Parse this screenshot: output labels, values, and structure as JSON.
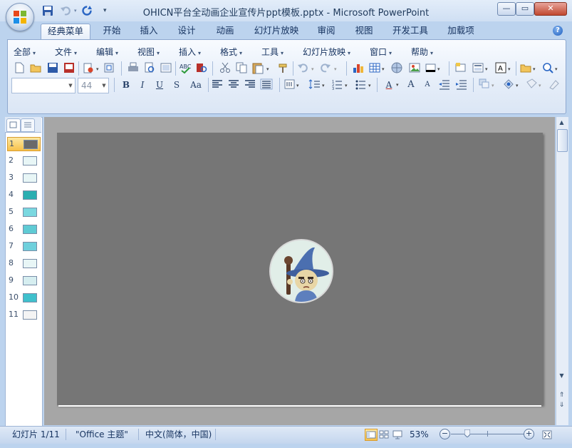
{
  "window": {
    "title": "OHICN平台全动画企业宣传片ppt模板.pptx - Microsoft PowerPoint",
    "controls": {
      "minimize": "—",
      "restore": "▭",
      "close": "✕"
    }
  },
  "quick_access": [
    "save-icon",
    "undo-icon",
    "redo-icon",
    "customize-icon"
  ],
  "ribbon_tabs": [
    {
      "label": "经典菜单",
      "active": true
    },
    {
      "label": "开始"
    },
    {
      "label": "插入"
    },
    {
      "label": "设计"
    },
    {
      "label": "动画"
    },
    {
      "label": "幻灯片放映"
    },
    {
      "label": "审阅"
    },
    {
      "label": "视图"
    },
    {
      "label": "开发工具"
    },
    {
      "label": "加载项"
    }
  ],
  "help_label": "?",
  "classic_menu": [
    "全部",
    "文件",
    "编辑",
    "视图",
    "插入",
    "格式",
    "工具",
    "幻灯片放映",
    "窗口",
    "帮助"
  ],
  "format_bar": {
    "font_name": "",
    "font_size": "44",
    "bold": "B",
    "italic": "I",
    "underline": "U",
    "shadow": "S",
    "case": "Aa",
    "font_color": "A",
    "grow": "A",
    "shrink": "A"
  },
  "slides_panel": {
    "tabs": [
      "slides-tab-icon",
      "outline-tab-icon"
    ],
    "thumbnails": [
      {
        "num": "1",
        "selected": true,
        "color": "#6a6a6a"
      },
      {
        "num": "2",
        "color": "#e8f6f6"
      },
      {
        "num": "3",
        "color": "#e8f6f6"
      },
      {
        "num": "4",
        "color": "#2aaeb1"
      },
      {
        "num": "5",
        "color": "#7ad8e0"
      },
      {
        "num": "6",
        "color": "#5fcbd4"
      },
      {
        "num": "7",
        "color": "#6fd0dc"
      },
      {
        "num": "8",
        "color": "#e8f6f6"
      },
      {
        "num": "9",
        "color": "#d6eef0"
      },
      {
        "num": "10",
        "color": "#3fc0cc"
      },
      {
        "num": "11",
        "color": "#f4f4f4"
      }
    ]
  },
  "slide": {
    "background": "#767676",
    "avatar": "wizard-avatar-image"
  },
  "status": {
    "slide_info": "幻灯片 1/11",
    "theme": "\"Office 主题\"",
    "language": "中文(简体，中国)",
    "zoom": "53%",
    "zoom_level_fraction": 0.22
  }
}
